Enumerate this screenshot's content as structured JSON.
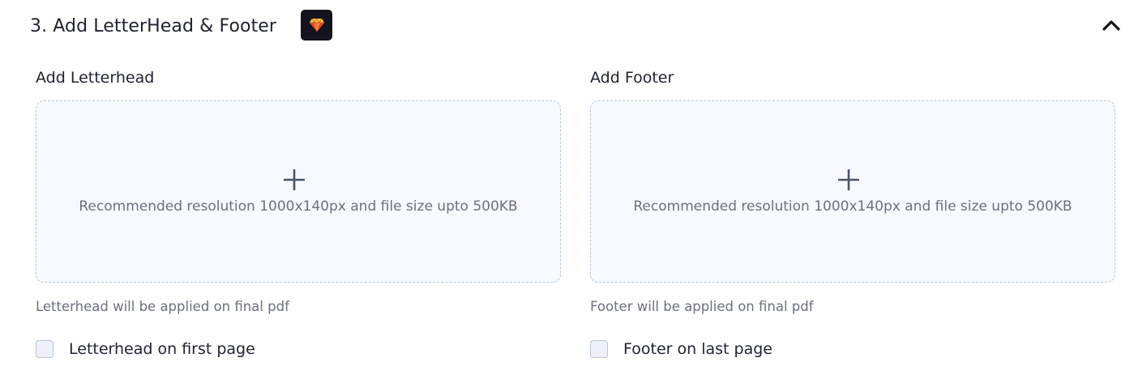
{
  "section": {
    "title": "3. Add LetterHead & Footer",
    "badge_icon": "diamond-icon",
    "toggle_icon": "chevron-up-icon",
    "expanded": true
  },
  "letterhead": {
    "label": "Add Letterhead",
    "upload_icon": "plus-icon",
    "upload_hint": "Recommended resolution 1000x140px and file size upto 500KB",
    "helper_text": "Letterhead will be applied on final pdf",
    "checkbox_label": "Letterhead on first page",
    "checkbox_checked": false
  },
  "footer": {
    "label": "Add Footer",
    "upload_icon": "plus-icon",
    "upload_hint": "Recommended resolution 1000x140px and file size upto 500KB",
    "helper_text": "Footer will be applied on final pdf",
    "checkbox_label": "Footer on last page",
    "checkbox_checked": false
  },
  "colors": {
    "text_primary": "#1f2230",
    "text_secondary": "#6a7180",
    "dropzone_bg": "#f6f9fd",
    "dropzone_border": "#b9c6d6",
    "badge_bg": "#15131d"
  }
}
